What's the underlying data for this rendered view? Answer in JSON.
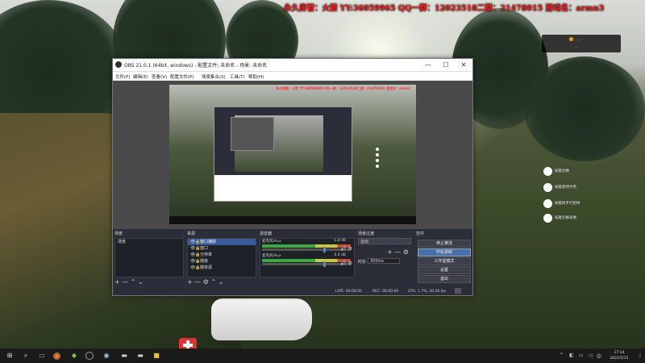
{
  "banner": "永久房管：火箭  YY:36059965  QQ一群：12023518二群：21478015  游戏名：armn3",
  "notification": {
    "line1": "...",
    "line2": "..."
  },
  "hud": {
    "items": [
      {
        "icon": "plus-icon",
        "label": "按着切换"
      },
      {
        "icon": "figure-icon",
        "label": "按着保持手势"
      },
      {
        "icon": "hand-icon",
        "label": "按着挥手打招呼"
      },
      {
        "icon": "gesture-icon",
        "label": "按着切换表情"
      }
    ]
  },
  "obs": {
    "title": "OBS 21.0.1 (64bit, windows) - 配置文件: 未命名 - 场景: 未命名",
    "window_buttons": {
      "minimize": "—",
      "maximize": "☐",
      "close": "✕"
    },
    "menu": [
      "文件(F)",
      "编辑(E)",
      "查看(V)",
      "配置文件(P)",
      "场景集合(S)",
      "工具(T)",
      "帮助(H)"
    ],
    "preview_banner": "永久房管：火箭 YY:36059965 QQ一群：12023518二群：21478015 游戏名：armn3",
    "panels": {
      "scenes": {
        "header": "场景",
        "items": [
          "场景"
        ],
        "footer": "+  —  ⌃  ⌄"
      },
      "sources": {
        "header": "来源",
        "items": [
          "窗口捕获",
          "窗口",
          "分辨率",
          "摄像",
          "媒体源"
        ],
        "footer": "+  —  ⚙  ⌃  ⌄"
      },
      "mixer": {
        "header": "混音器",
        "channels": [
          {
            "name": "麦克风/Aux",
            "db": "-1.8 dB",
            "controls": "🔊 ⚙"
          },
          {
            "name": "麦克风/Aux",
            "db": "0.0 dB",
            "controls": "🔊 ⚙"
          }
        ]
      },
      "transitions": {
        "header": "场景过渡",
        "type": "淡出",
        "duration_label": "时长",
        "duration_value": "300ms",
        "footer": "+  —  ⚙"
      },
      "controls": {
        "header": "控件",
        "buttons": [
          "停止推流",
          "开始录制",
          "工作室模式",
          "设置",
          "退出"
        ]
      }
    },
    "status": {
      "live": "LIVE: 00:00:00",
      "rec": "REC: 00:00:00",
      "cpu": "CPU: 1.7%, 30.00 fps"
    }
  },
  "taskbar": {
    "start": "⊞",
    "search": "⌕",
    "time": "17:14",
    "date": "2022/5/15"
  }
}
